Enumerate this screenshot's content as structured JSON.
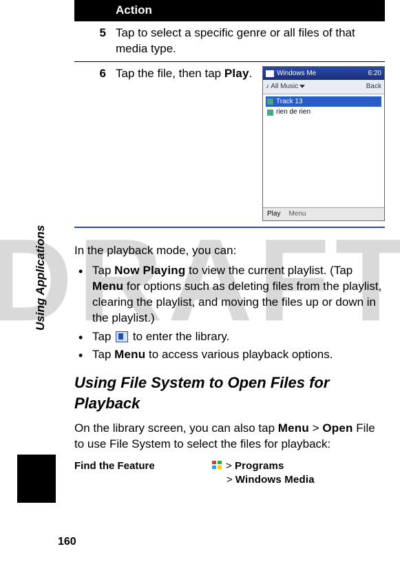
{
  "watermark": "DRAFT",
  "sidebar_label": "Using Applications",
  "page_number": "160",
  "table": {
    "header": "Action",
    "rows": [
      {
        "num": "5",
        "text_before": "Tap to select a specific genre or all files of that media type.",
        "bold1": "",
        "text_mid": "",
        "bold2": "",
        "text_after": ""
      },
      {
        "num": "6",
        "text_before": "Tap the file, then tap ",
        "bold1": "Play",
        "text_mid": ".",
        "bold2": "",
        "text_after": ""
      }
    ]
  },
  "mock": {
    "title": "Windows Me",
    "time_icons": "6:20",
    "toolbar_left": "All Music",
    "toolbar_right": "Back",
    "tracks": [
      "Track 13",
      "rien de rien"
    ],
    "footer_play": "Play",
    "footer_menu": "Menu"
  },
  "para_intro": "In the playback mode, you can:",
  "bullets": [
    {
      "pre": "Tap ",
      "b1": "Now Playing",
      "mid": " to view the current playlist. (Tap ",
      "b2": "Menu",
      "post": " for options such as deleting files from the playlist, clearing the playlist, and moving the files up or down in the playlist.)"
    },
    {
      "pre": "Tap ",
      "icon": true,
      "mid": " to enter the library.",
      "b1": "",
      "b2": "",
      "post": ""
    },
    {
      "pre": "Tap ",
      "b1": "Menu",
      "mid": " to access various playback options.",
      "b2": "",
      "post": ""
    }
  ],
  "subheading": "Using File System to Open Files for Playback",
  "para_body_pre": "On the library screen, you can also tap ",
  "para_body_b1": "Menu",
  "para_body_sep": " > ",
  "para_body_b2": "Open",
  "para_body_post": " File to use File System to select the files for playback:",
  "find": {
    "label": "Find the Feature",
    "path_sep": ">",
    "path1": "Programs",
    "path2": "Windows Media"
  }
}
